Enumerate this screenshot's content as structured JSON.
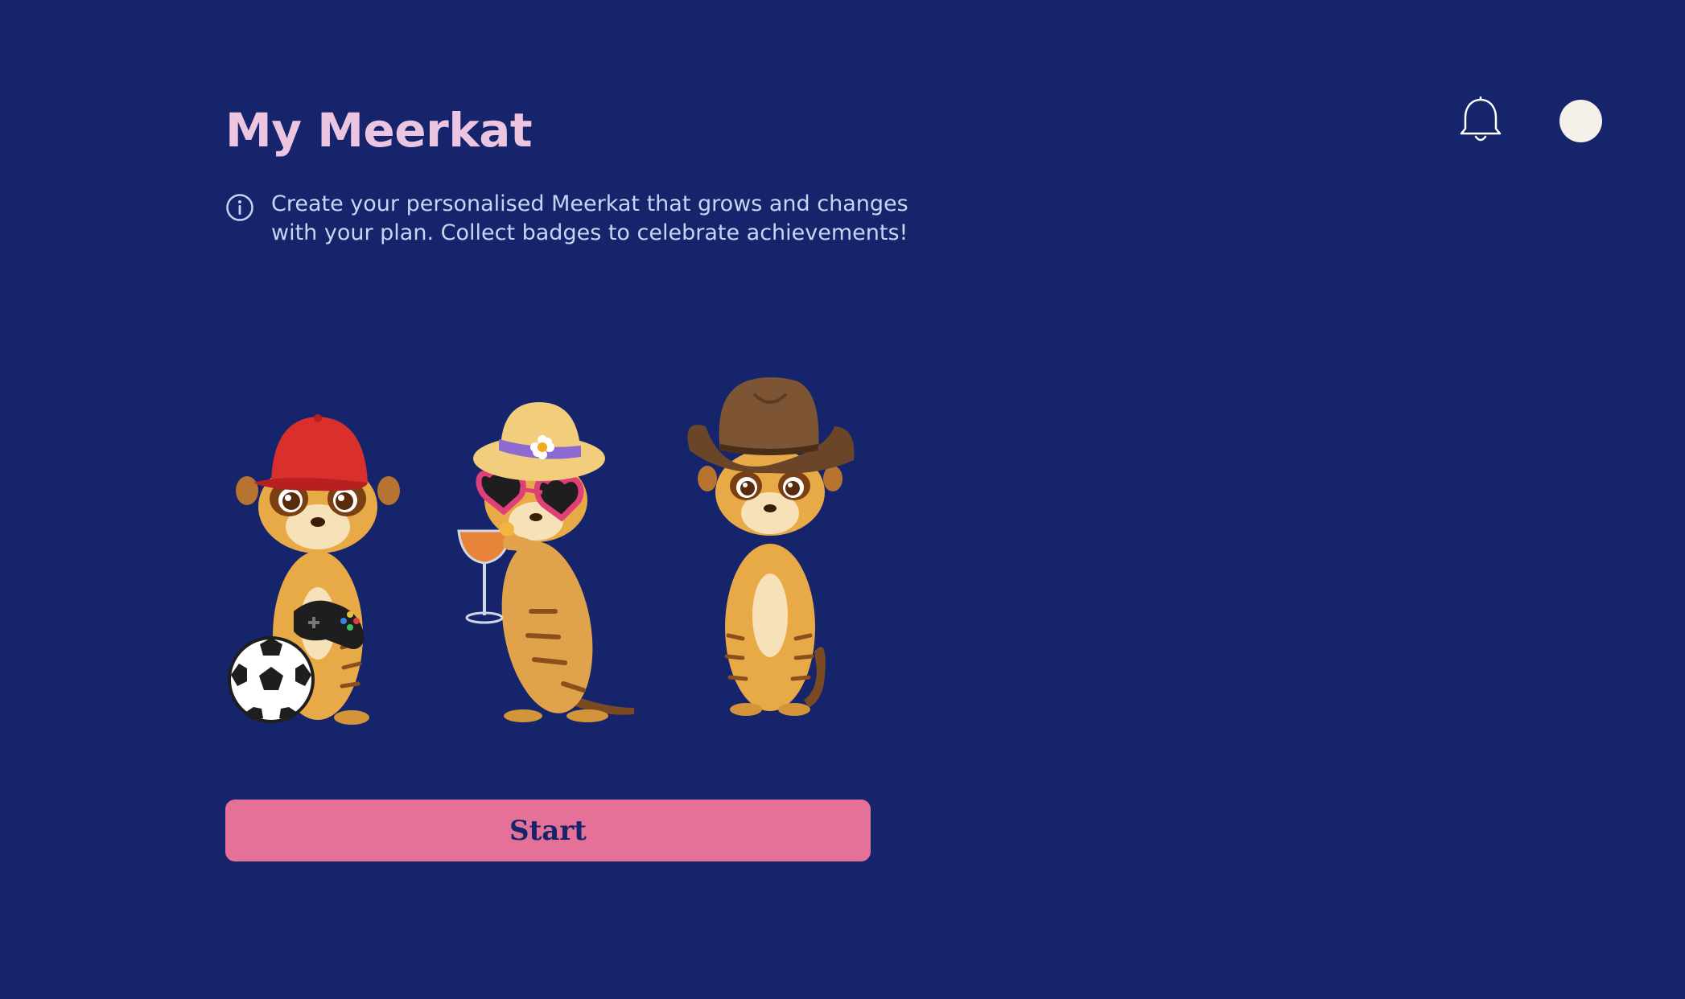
{
  "header": {
    "title": "My Meerkat",
    "notifications_icon": "bell-icon",
    "profile_icon": "avatar-circle"
  },
  "intro": {
    "icon": "info-icon",
    "text": "Create your personalised Meerkat that grows and changes with your plan. Collect badges to celebrate achievements!"
  },
  "illustration": {
    "meerkats": [
      {
        "name": "sporty-meerkat",
        "accessories": [
          "red-cap",
          "game-controller",
          "soccer-ball"
        ]
      },
      {
        "name": "summer-meerkat",
        "accessories": [
          "sun-hat",
          "heart-sunglasses",
          "cocktail-glass"
        ]
      },
      {
        "name": "cowboy-meerkat",
        "accessories": [
          "cowboy-hat"
        ]
      }
    ]
  },
  "actions": {
    "start_label": "Start"
  },
  "colors": {
    "background": "#16256b",
    "title": "#ecc6e0",
    "body_text": "#c9d4f5",
    "button": "#e57198",
    "avatar": "#f5f0e8"
  }
}
